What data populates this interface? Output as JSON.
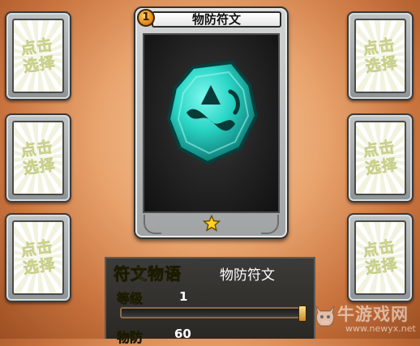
{
  "slots": {
    "placeholder_line1": "点击",
    "placeholder_line2": "选择"
  },
  "card": {
    "level_badge": "1",
    "title": "物防符文",
    "stars": 1
  },
  "info_panel": {
    "heading": "符文物语",
    "rune_name": "物防符文",
    "level_label": "等级",
    "level_value": "1",
    "progress": 0.0,
    "defense_label": "物防",
    "defense_value": "60"
  },
  "watermark": {
    "text": "牛游戏网",
    "url": "www.newyx.net"
  },
  "colors": {
    "background": "#e9a46e",
    "rune_gem": "#2ad6c6",
    "heading_text": "#e9f5a0",
    "progress_end": "#f7b84a"
  }
}
